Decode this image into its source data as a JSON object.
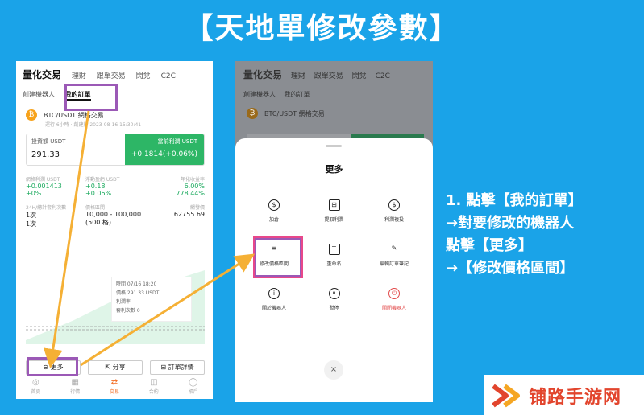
{
  "title": "【天地單修改參數】",
  "left_app": {
    "nav": [
      "量化交易",
      "理財",
      "跟單交易",
      "閃兌",
      "C2C"
    ],
    "subnav": [
      "創建機器人",
      "我的訂單"
    ],
    "bot_name": "BTC/USDT 網格交易",
    "bot_sub": "運行 6小時 · 創建於 2023-08-16 15:30:41",
    "invest_label": "投資額 USDT",
    "invest_value": "291.33",
    "profit_label": "當前利潤 USDT",
    "profit_value": "+0.1814(+0.06%)",
    "stats": [
      {
        "label": "網格利潤 USDT",
        "value": "+0.001413",
        "sub": "+0%"
      },
      {
        "label": "浮動盈虧 USDT",
        "value": "+0.18",
        "sub": "+0.06%"
      },
      {
        "label": "年化收益率",
        "value": "6.00%",
        "sub": "778.44%"
      }
    ],
    "stats2": [
      {
        "label": "24H/總計套利次數",
        "value": "1次",
        "sub": "1次"
      },
      {
        "label": "價格區間",
        "value": "10,000 - 100,000",
        "sub": "(500 格)"
      },
      {
        "label": "觸發價",
        "value": "62755.69"
      }
    ],
    "tooltip": [
      "時間    07/16 18:20",
      "價格    291.33 USDT",
      "利潤率",
      "套利次數    0"
    ],
    "actions": [
      "⊖ 更多",
      "⇱ 分享",
      "⊟ 訂單詳情"
    ],
    "tabbar": [
      {
        "icon": "◎",
        "label": "首頁"
      },
      {
        "icon": "▦",
        "label": "行情"
      },
      {
        "icon": "⇄",
        "label": "交易"
      },
      {
        "icon": "◫",
        "label": "合約"
      },
      {
        "icon": "◯",
        "label": "帳戶"
      }
    ]
  },
  "right_app": {
    "nav": [
      "量化交易",
      "理財",
      "跟單交易",
      "閃兌",
      "C2C"
    ],
    "subnav": [
      "創建機器人",
      "我的訂單"
    ],
    "bot_name": "BTC/USDT 網格交易",
    "sheet_title": "更多",
    "items": [
      {
        "icon": "$",
        "label": "加倉"
      },
      {
        "icon": "⊟",
        "label": "提取利潤"
      },
      {
        "icon": "$",
        "label": "利潤複投"
      },
      {
        "icon": "≡",
        "label": "修改價格區間"
      },
      {
        "icon": "T",
        "label": "重命名"
      },
      {
        "icon": "✎",
        "label": "編輯訂單筆記"
      },
      {
        "icon": "i",
        "label": "關於機器人"
      },
      {
        "icon": "⏸",
        "label": "暫停"
      },
      {
        "icon": "⏻",
        "label": "關閉機器人"
      }
    ],
    "close": "×"
  },
  "instructions": [
    "1. 點擊【我的訂單】",
    "→對要修改的機器人",
    "點擊【更多】",
    "→【修改價格區間】"
  ],
  "brand": "铺路手游网",
  "colors": {
    "bg": "#1aa3e8",
    "green": "#2db666",
    "highlight_purple": "#9b59b6",
    "highlight_pink": "#e8488a",
    "arrow": "#f5b035",
    "brand": "#e2452d"
  }
}
